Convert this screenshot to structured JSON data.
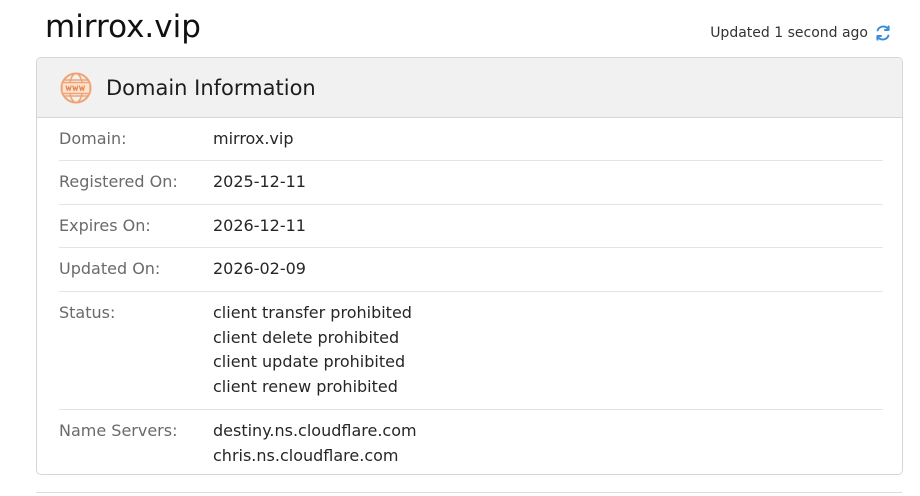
{
  "page": {
    "title": "mirrox.vip",
    "updated_text": "Updated 1 second ago"
  },
  "card": {
    "title": "Domain Information",
    "icon": "www-icon",
    "rows": [
      {
        "label": "Domain:",
        "values": [
          "mirrox.vip"
        ]
      },
      {
        "label": "Registered On:",
        "values": [
          "2025-12-11"
        ]
      },
      {
        "label": "Expires On:",
        "values": [
          "2026-12-11"
        ]
      },
      {
        "label": "Updated On:",
        "values": [
          "2026-02-09"
        ]
      },
      {
        "label": "Status:",
        "values": [
          "client transfer prohibited",
          "client delete prohibited",
          "client update prohibited",
          "client renew prohibited"
        ]
      },
      {
        "label": "Name Servers:",
        "values": [
          "destiny.ns.cloudflare.com",
          "chris.ns.cloudflare.com"
        ]
      }
    ]
  },
  "colors": {
    "accent_orange": "#f0a474",
    "refresh_blue": "#3b8fd9"
  }
}
